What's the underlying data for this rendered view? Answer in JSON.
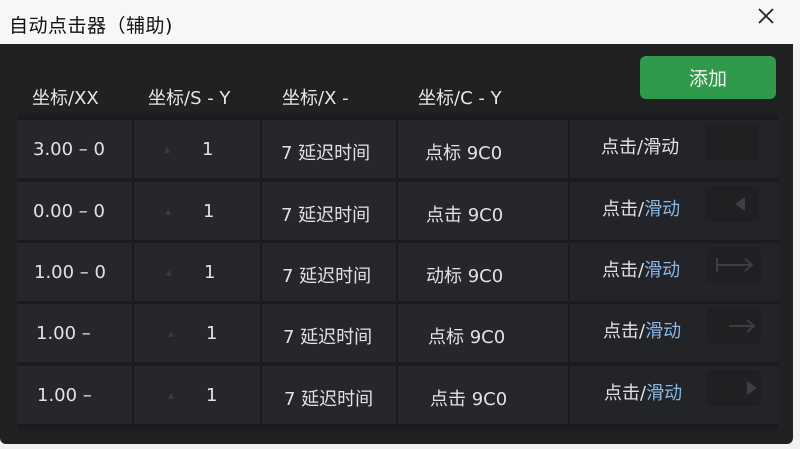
{
  "window": {
    "title": "自动点击器（辅助)"
  },
  "toolbar": {
    "add_label": "添加"
  },
  "table": {
    "headers": [
      "坐标/XX",
      "坐标/S - Y",
      "坐标/X -",
      "坐标/C - Y"
    ],
    "rows": [
      {
        "coord": "3.00 – 0",
        "count": "1",
        "delay": "7 延迟时间",
        "target": "点标 9C0",
        "action_a": "点击/",
        "action_b": "滑动",
        "action_b_highlight": false,
        "icon": "blank-icon"
      },
      {
        "coord": "0.00 – 0",
        "count": "1",
        "delay": "7 延迟时间",
        "target": "点击 9C0",
        "action_a": "点击/",
        "action_b": "滑动",
        "action_b_highlight": true,
        "icon": "triangle-left-icon"
      },
      {
        "coord": "1.00 – 0",
        "count": "1",
        "delay": "7 延迟时间",
        "target": "动标 9C0",
        "action_a": "点击/",
        "action_b": "滑动",
        "action_b_highlight": true,
        "icon": "swipe-right-icon"
      },
      {
        "coord": "1.00 –",
        "count": "1",
        "delay": "7 延迟时间",
        "target": "点标 9C0",
        "action_a": "点击/",
        "action_b": "滑动",
        "action_b_highlight": true,
        "icon": "arrow-right-icon"
      },
      {
        "coord": "1.00 –",
        "count": "1",
        "delay": "7 延迟时间",
        "target": "点击 9C0",
        "action_a": "点击/",
        "action_b": "滑动",
        "action_b_highlight": true,
        "icon": "play-icon"
      }
    ]
  },
  "colors": {
    "panel": "#202123",
    "accent_green": "#2f9a4c",
    "link_blue": "#8ab8e6"
  }
}
